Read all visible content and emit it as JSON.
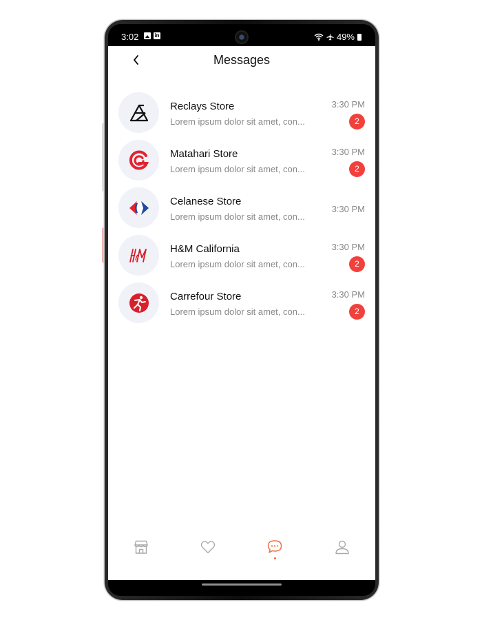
{
  "status_bar": {
    "time": "3:02",
    "battery": "49%"
  },
  "header": {
    "title": "Messages",
    "back_icon": "chevron-left-icon"
  },
  "messages": [
    {
      "name": "Reclays Store",
      "preview": "Lorem ipsum dolor sit amet, con...",
      "time": "3:30 PM",
      "unread": "2",
      "logo": "reclays-logo",
      "logo_color": "#111111"
    },
    {
      "name": "Matahari Store",
      "preview": "Lorem ipsum dolor sit amet, con...",
      "time": "3:30 PM",
      "unread": "2",
      "logo": "matahari-logo",
      "logo_color": "#e2232f"
    },
    {
      "name": "Celanese Store",
      "preview": "Lorem ipsum dolor sit amet, con...",
      "time": "3:30 PM",
      "unread": "",
      "logo": "carrefour-style-logo",
      "logo_color": "#1f4aa0"
    },
    {
      "name": "H&M California",
      "preview": "Lorem ipsum dolor sit amet, con...",
      "time": "3:30 PM",
      "unread": "2",
      "logo": "hm-logo",
      "logo_color": "#d21f2b"
    },
    {
      "name": "Carrefour Store",
      "preview": "Lorem ipsum dolor sit amet, con...",
      "time": "3:30 PM",
      "unread": "2",
      "logo": "runner-logo",
      "logo_color": "#d7202c"
    }
  ],
  "colors": {
    "badge": "#f2413c",
    "accent": "#f0693a",
    "inactive_icon": "#a9a9a9",
    "avatar_bg": "#f1f1f8"
  },
  "bottom_nav": {
    "items": [
      {
        "icon": "store-icon",
        "active": false
      },
      {
        "icon": "heart-icon",
        "active": false
      },
      {
        "icon": "chat-icon",
        "active": true
      },
      {
        "icon": "user-icon",
        "active": false
      }
    ]
  }
}
